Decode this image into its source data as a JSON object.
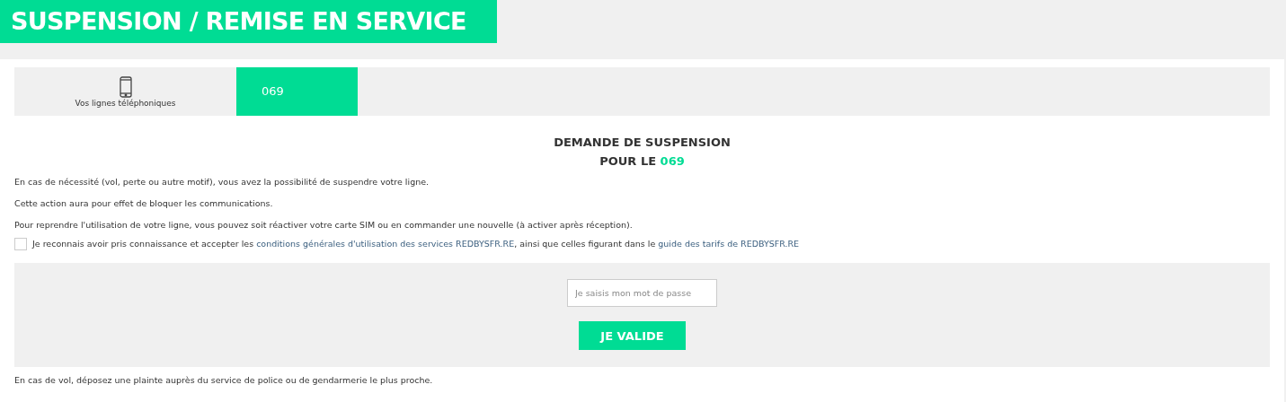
{
  "page_title": "SUSPENSION / REMISE EN SERVICE",
  "tabs": [
    {
      "kind": "icon",
      "label": "Vos lignes téléphoniques",
      "selected": false
    },
    {
      "kind": "number",
      "label": "069",
      "selected": true
    }
  ],
  "heading": {
    "line_1": "DEMANDE DE SUSPENSION",
    "line_2_prefix": "POUR LE",
    "line_2_number": "069"
  },
  "paragraphs": [
    "En cas de nécessité (vol, perte ou autre motif), vous avez la possibilité de suspendre votre ligne.",
    "Cette action aura pour effet de bloquer les communications.",
    "Pour reprendre l'utilisation de votre ligne, vous pouvez soit réactiver votre carte SIM ou en commander une nouvelle (à activer après réception)."
  ],
  "consent": {
    "checked": false,
    "text_before": "Je reconnais avoir pris connaissance et accepter les",
    "link_1": "conditions générales d'utilisation des services REDBYSFR.RE",
    "text_middle": ", ainsi que celles figurant dans le",
    "link_2": "guide des tarifs de REDBYSFR.RE"
  },
  "password_field": {
    "placeholder": "Je saisis mon mot de passe"
  },
  "submit_button": "JE VALIDE",
  "footer_note": "En cas de vol, déposez une plainte auprès du service de police ou de gendarmerie le plus proche."
}
